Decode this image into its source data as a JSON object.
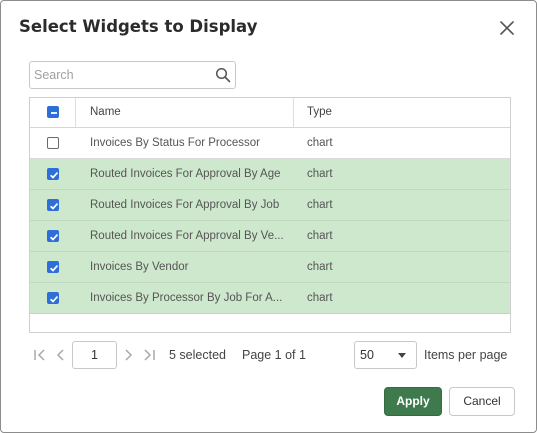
{
  "dialog": {
    "title": "Select Widgets to Display"
  },
  "search": {
    "placeholder": "Search"
  },
  "grid": {
    "columns": [
      "Name",
      "Type"
    ],
    "rows": [
      {
        "name": "Invoices By Status For Processor",
        "type": "chart",
        "selected": false
      },
      {
        "name": "Routed Invoices For Approval By Age",
        "type": "chart",
        "selected": true
      },
      {
        "name": "Routed Invoices For Approval By Job",
        "type": "chart",
        "selected": true
      },
      {
        "name": "Routed Invoices For Approval By Ve...",
        "type": "chart",
        "selected": true
      },
      {
        "name": "Invoices By Vendor",
        "type": "chart",
        "selected": true
      },
      {
        "name": "Invoices By Processor By Job For A...",
        "type": "chart",
        "selected": true
      }
    ]
  },
  "pager": {
    "page": "1",
    "selected_text": "5 selected",
    "page_text": "Page 1 of 1",
    "items_per_page": "50",
    "items_per_page_label": "Items per page"
  },
  "buttons": {
    "apply": "Apply",
    "cancel": "Cancel"
  },
  "colors": {
    "selected_row": "#cde8cd",
    "checkbox": "#2d6fd6",
    "apply": "#3f7a4c"
  }
}
